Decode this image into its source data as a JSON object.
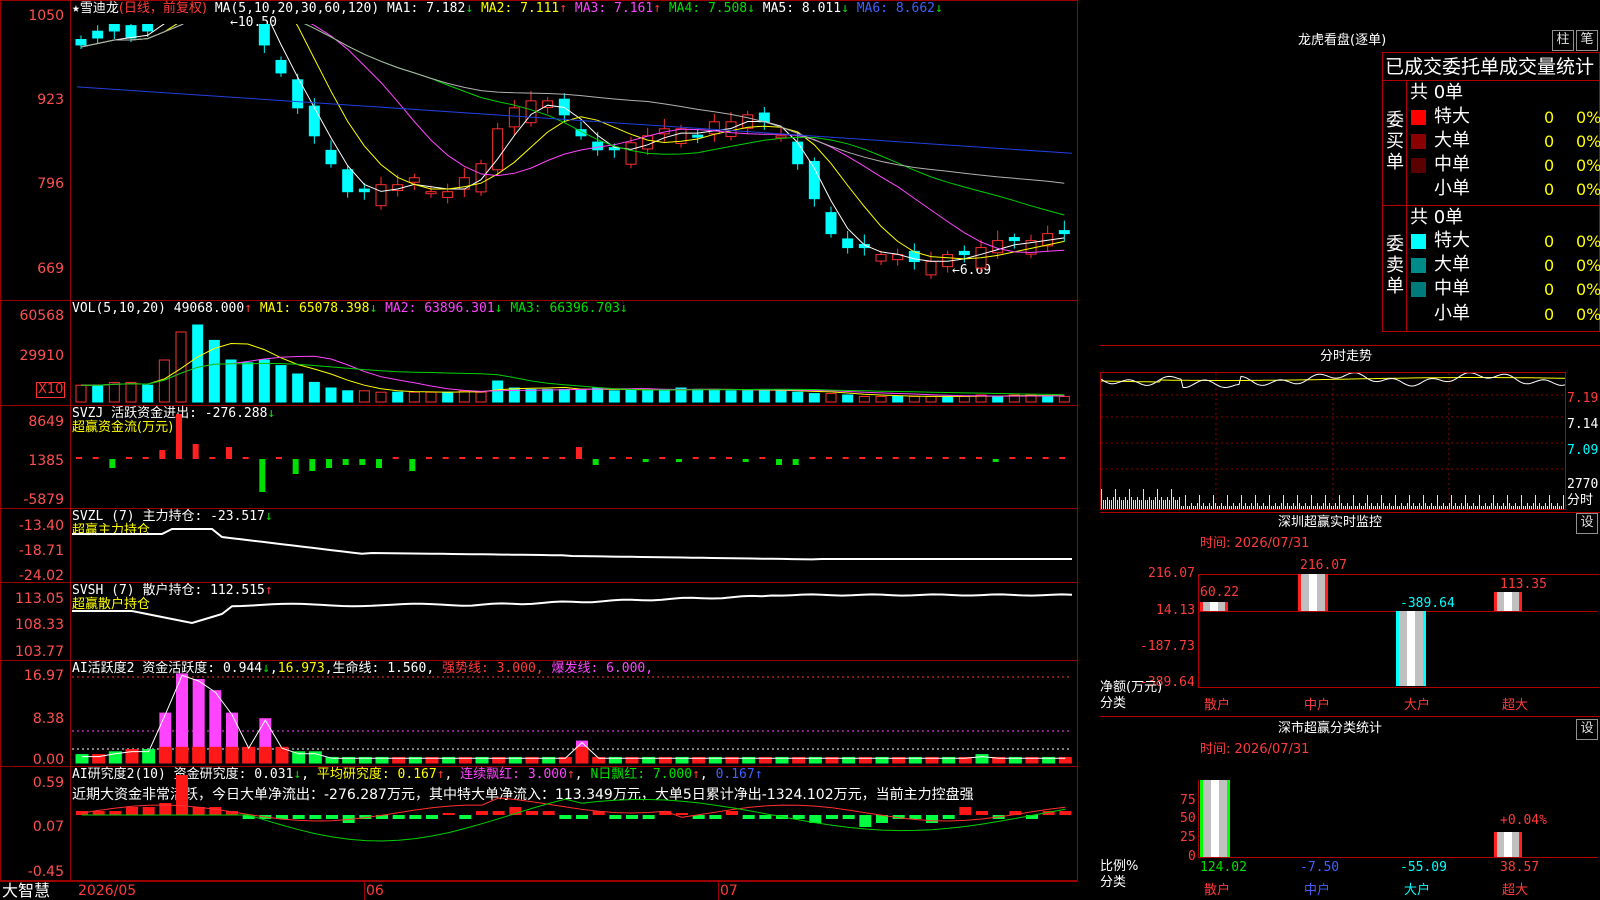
{
  "main_chart": {
    "star": "★",
    "stock_name": "雪迪龙",
    "period": "(日线，前复权)",
    "ma_params": "MA(5,10,20,30,60,120)",
    "ma1": "MA1: 7.182",
    "ma2": "MA2: 7.111",
    "ma3": "MA3: 7.161",
    "ma4": "MA4: 7.508",
    "ma5": "MA5: 8.011",
    "ma6": "MA6: 8.662",
    "ma1_arrow": "↓",
    "ma2_arrow": "↑",
    "ma3_arrow": "↑",
    "ma4_arrow": "↓",
    "ma5_arrow": "↓",
    "ma6_arrow": "↓",
    "high_note": "←10.50",
    "low_note": "←6.69",
    "y_ticks": [
      "1050",
      "923",
      "796",
      "669"
    ]
  },
  "vol_chart": {
    "title": "VOL(5,10,20)",
    "value": "49068.000",
    "arrow": "↑",
    "ma1": "MA1: 65078.398",
    "ma2": "MA2: 63896.301",
    "ma3": "MA3: 66396.703",
    "arrows": [
      "↓",
      "↓",
      "↓"
    ],
    "y_ticks": [
      "60568",
      "29910"
    ],
    "unit": "X10"
  },
  "svzj": {
    "title": "SVZJ  活跃资金进出: -276.288",
    "arrow": "↓",
    "subtitle": "超赢资金流(万元)",
    "y_ticks": [
      "8649",
      "1385",
      "-5879"
    ]
  },
  "svzl": {
    "title": "SVZL (7) 主力持仓: -23.517",
    "arrow": "↓",
    "subtitle": "超赢主力持仓",
    "y_ticks": [
      "-13.40",
      "-18.71",
      "-24.02"
    ]
  },
  "svsh": {
    "title": "SVSH (7) 散户持仓: 112.515",
    "arrow": "↑",
    "subtitle": "超赢散户持仓",
    "y_ticks": [
      "113.05",
      "108.33",
      "103.77"
    ]
  },
  "ai_active": {
    "title": "AI活跃度2 资金活跃度: 0.944",
    "arrow1": "↓",
    "v2": "16.973",
    "life": "生命线: 1.560",
    "strong": "强势线: 3.000",
    "burst": "爆发线: 6.000",
    "y_ticks": [
      "16.97",
      "8.38",
      "0.00"
    ]
  },
  "ai_research": {
    "title": "AI研究度2(10) 资金研究度: 0.031",
    "arrow1": "↓",
    "avg": "平均研究度: 0.167",
    "avg_arrow": "↑",
    "cont": "连续飘红: 3.000",
    "cont_arrow": "↑",
    "ndays": "N日飘红: 7.000",
    "ndays_arrow": "↑",
    "last": "0.167",
    "last_arrow": "↑",
    "summary": "近期大资金非常活跃，今日大单净流出：-276.287万元，其中特大单净流入：113.349万元，大单5日累计净出-1324.102万元，当前主力控盘强",
    "y_ticks": [
      "0.59",
      "0.07",
      "-0.45"
    ]
  },
  "x_axis": {
    "brand": "大智慧",
    "labels": [
      "2026/05",
      "06",
      "07"
    ]
  },
  "right_panel": {
    "lhb_title": "龙虎看盘(逐单)",
    "btn_bar": "柱",
    "btn_pen": "笔",
    "order_stat_title": "已成交委托单成交量统计",
    "buy_label": "委买单",
    "sell_label": "委卖单",
    "buy_total": "共 0单",
    "sell_total": "共 0单",
    "buy_rows": [
      {
        "name": "特大",
        "count": "0",
        "pct": "0%",
        "color": "#ff0000"
      },
      {
        "name": "大单",
        "count": "0",
        "pct": "0%",
        "color": "#8b0000"
      },
      {
        "name": "中单",
        "count": "0",
        "pct": "0%",
        "color": "#5a0000"
      },
      {
        "name": "小单",
        "count": "0",
        "pct": "0%",
        "color": ""
      }
    ],
    "sell_rows": [
      {
        "name": "特大",
        "count": "0",
        "pct": "0%",
        "color": "#00ffff"
      },
      {
        "name": "大单",
        "count": "0",
        "pct": "0%",
        "color": "#008b8b"
      },
      {
        "name": "中单",
        "count": "0",
        "pct": "0%",
        "color": "#007a7a"
      },
      {
        "name": "小单",
        "count": "0",
        "pct": "0%",
        "color": ""
      }
    ],
    "intraday_title": "分时走势",
    "intraday_y": [
      "7.19",
      "7.14",
      "7.09"
    ],
    "intraday_vol": "2770",
    "intraday_vol_unit": "分时",
    "sz_title": "深圳超赢实时监控",
    "settings": "设",
    "sz_time": "时间: 2026/07/31",
    "sz_y": [
      "216.07",
      "14.13",
      "-187.73",
      "-389.64"
    ],
    "sz_ylabel": "净额(万元)",
    "sz_xlabel": "分类",
    "sz_bars": [
      {
        "cat": "散户",
        "value": "60.22"
      },
      {
        "cat": "中户",
        "value": "216.07"
      },
      {
        "cat": "大户",
        "value": "-389.64"
      },
      {
        "cat": "超大",
        "value": "113.35"
      }
    ],
    "class_title": "深市超赢分类统计",
    "class_time": "时间: 2026/07/31",
    "class_y": [
      "75",
      "50",
      "25",
      "0"
    ],
    "class_ylabel": "比例%",
    "class_xlabel": "分类",
    "class_note": "+0.04%",
    "class_bars": [
      {
        "cat": "散户",
        "value": "124.02"
      },
      {
        "cat": "中户",
        "value": "-7.50"
      },
      {
        "cat": "大户",
        "value": "-55.09"
      },
      {
        "cat": "超大",
        "value": "38.57"
      }
    ]
  }
}
